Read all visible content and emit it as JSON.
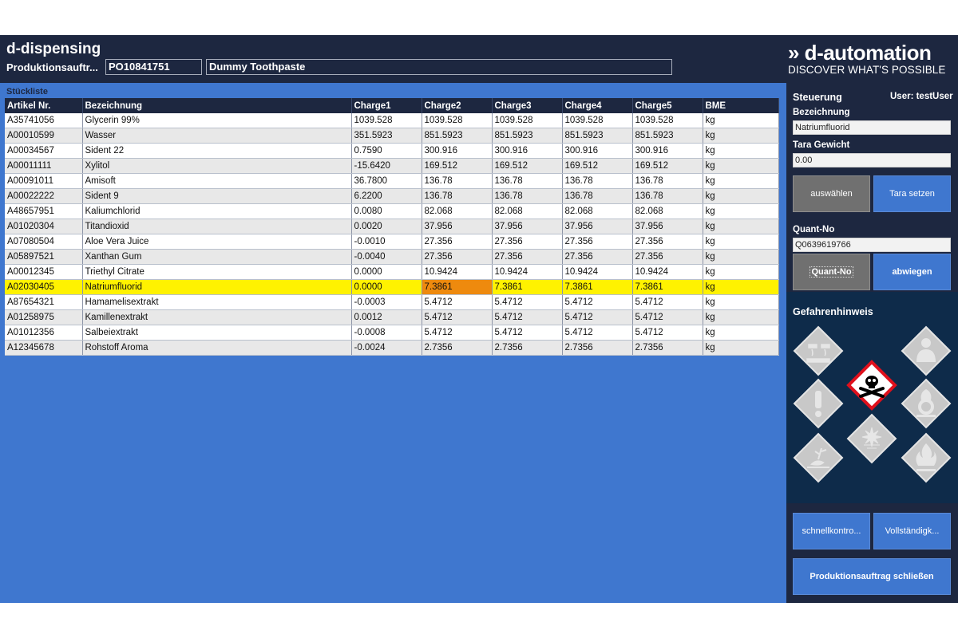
{
  "header": {
    "app_title": "d-dispensing",
    "order_label": "Produktionsauftr...",
    "order_number": "PO10841751",
    "order_description": "Dummy Toothpaste"
  },
  "bom": {
    "title": "Stückliste",
    "columns": [
      "Artikel Nr.",
      "Bezeichnung",
      "Charge1",
      "Charge2",
      "Charge3",
      "Charge4",
      "Charge5",
      "BME"
    ],
    "selected_row": 11,
    "active_charge_column": 3,
    "rows": [
      [
        "A35741056",
        "Glycerin 99%",
        "1039.528",
        "1039.528",
        "1039.528",
        "1039.528",
        "1039.528",
        "kg"
      ],
      [
        "A00010599",
        "Wasser",
        "351.5923",
        "851.5923",
        "851.5923",
        "851.5923",
        "851.5923",
        "kg"
      ],
      [
        "A00034567",
        "Sident 22",
        "0.7590",
        "300.916",
        "300.916",
        "300.916",
        "300.916",
        "kg"
      ],
      [
        "A00011111",
        "Xylitol",
        "-15.6420",
        "169.512",
        "169.512",
        "169.512",
        "169.512",
        "kg"
      ],
      [
        "A00091011",
        "Amisoft",
        "36.7800",
        "136.78",
        "136.78",
        "136.78",
        "136.78",
        "kg"
      ],
      [
        "A00022222",
        "Sident 9",
        "6.2200",
        "136.78",
        "136.78",
        "136.78",
        "136.78",
        "kg"
      ],
      [
        "A48657951",
        "Kaliumchlorid",
        "0.0080",
        "82.068",
        "82.068",
        "82.068",
        "82.068",
        "kg"
      ],
      [
        "A01020304",
        "Titandioxid",
        "0.0020",
        "37.956",
        "37.956",
        "37.956",
        "37.956",
        "kg"
      ],
      [
        "A07080504",
        "Aloe Vera Juice",
        "-0.0010",
        "27.356",
        "27.356",
        "27.356",
        "27.356",
        "kg"
      ],
      [
        "A05897521",
        "Xanthan Gum",
        "-0.0040",
        "27.356",
        "27.356",
        "27.356",
        "27.356",
        "kg"
      ],
      [
        "A00012345",
        "Triethyl Citrate",
        "0.0000",
        "10.9424",
        "10.9424",
        "10.9424",
        "10.9424",
        "kg"
      ],
      [
        "A02030405",
        "Natriumfluorid",
        "0.0000",
        "7.3861",
        "7.3861",
        "7.3861",
        "7.3861",
        "kg"
      ],
      [
        "A87654321",
        "Hamamelisextrakt",
        "-0.0003",
        "5.4712",
        "5.4712",
        "5.4712",
        "5.4712",
        "kg"
      ],
      [
        "A01258975",
        "Kamillenextrakt",
        "0.0012",
        "5.4712",
        "5.4712",
        "5.4712",
        "5.4712",
        "kg"
      ],
      [
        "A01012356",
        "Salbeiextrakt",
        "-0.0008",
        "5.4712",
        "5.4712",
        "5.4712",
        "5.4712",
        "kg"
      ],
      [
        "A12345678",
        "Rohstoff Aroma",
        "-0.0024",
        "2.7356",
        "2.7356",
        "2.7356",
        "2.7356",
        "kg"
      ]
    ]
  },
  "logo": {
    "main": "» d-automation",
    "sub": "DISCOVER WHAT'S POSSIBLE"
  },
  "panel": {
    "title": "Steuerung",
    "user": "User: testUser",
    "bezeichnung_label": "Bezeichnung",
    "bezeichnung_value": "Natriumfluorid",
    "tara_label": "Tara Gewicht",
    "tara_value": "0.00",
    "btn_select": "auswählen",
    "btn_tara": "Tara setzen",
    "quant_label": "Quant-No",
    "quant_value": "Q0639619766",
    "btn_quant": "Quant-No",
    "btn_weigh": "abwiegen"
  },
  "hazards": {
    "title": "Gefahrenhinweis",
    "icons": [
      {
        "name": "corrosive-icon",
        "active": false
      },
      {
        "name": "health-hazard-icon",
        "active": false
      },
      {
        "name": "toxic-skull-icon",
        "active": true
      },
      {
        "name": "exclamation-icon",
        "active": false
      },
      {
        "name": "oxidizer-icon",
        "active": false
      },
      {
        "name": "explosive-icon",
        "active": false
      },
      {
        "name": "environment-icon",
        "active": false
      },
      {
        "name": "flammable-icon",
        "active": false
      }
    ]
  },
  "footer": {
    "btn_quick": "schnellkontro...",
    "btn_complete": "Vollständigk...",
    "btn_close_order": "Produktionsauftrag schließen"
  },
  "colors": {
    "dark": "#1d2740",
    "blue": "#3f77cf",
    "highlight": "#fff200",
    "active": "#ee8a0e"
  }
}
